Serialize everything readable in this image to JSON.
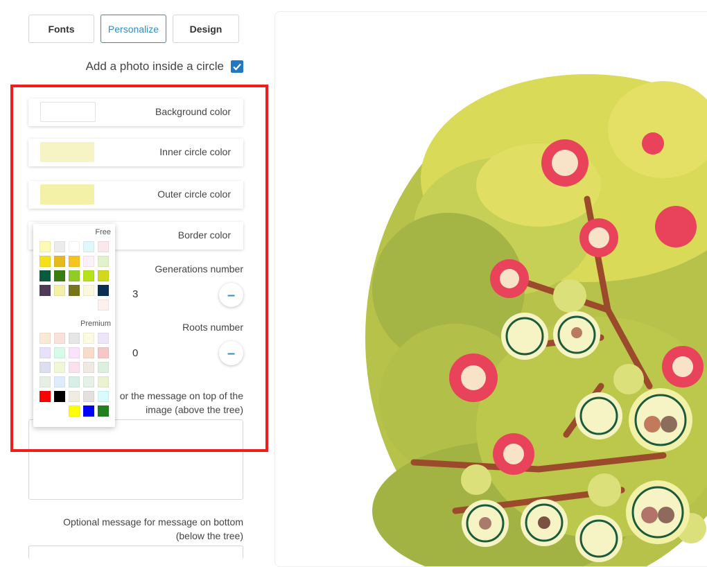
{
  "tabs": [
    {
      "label": "Fonts"
    },
    {
      "label": "Personalize"
    },
    {
      "label": "Design"
    }
  ],
  "photo_option": {
    "label": "Add a photo inside a circle",
    "checked": true
  },
  "colors": {
    "background": {
      "label": "Background color",
      "value": "#ffffff"
    },
    "inner": {
      "label": "Inner circle color",
      "value": "#f6f4c4"
    },
    "outer": {
      "label": "Outer circle color",
      "value": "#f3f0a8"
    },
    "border": {
      "label": "Border color"
    }
  },
  "generations": {
    "label": "Generations number",
    "value": "3"
  },
  "roots": {
    "label": "Roots number",
    "value": "0"
  },
  "top_message": {
    "label": "or the message on top of the image (above the tree)",
    "line1": "or the message on top of the",
    "line2": "image (above the tree)"
  },
  "bottom_message": {
    "line1": "Optional message for message on bottom",
    "line2": "(below the tree)"
  },
  "picker": {
    "free_label": "Free",
    "premium_label": "Premium",
    "free_colors": [
      "#fbfbb4",
      "#ececec",
      "#ffffff",
      "#e1f8fb",
      "#fbe7ec",
      "#f4e11c",
      "#e6b91f",
      "#f7c31e",
      "#fcf1fb",
      "#e2f2ca",
      "#0a5b3b",
      "#3a7d12",
      "#8fcc26",
      "#b6e21c",
      "#d2d81c",
      "#4e3a56",
      "#f5f0a8",
      "#77751c",
      "#faf7dc",
      "#092f52",
      "#ffffff",
      "#ffffff",
      "#ffffff",
      "#ffffff",
      "#fdf1ee"
    ],
    "premium_colors": [
      "#fbe9d6",
      "#fbe1dc",
      "#e6e6e6",
      "#fbfbe2",
      "#ede6fb",
      "#e6e2fb",
      "#d6fbe6",
      "#fbe2fb",
      "#f8dccc",
      "#f7c7c7",
      "#dcdff0",
      "#eff7d6",
      "#fbe1ed",
      "#f0e8e1",
      "#ddf0de",
      "#e6eee6",
      "#dfecfb",
      "#d8eee6",
      "#e6f0e6",
      "#eaf2d2",
      "#ff0000",
      "#000000",
      "#f0ece1",
      "#e4e0e0",
      "#d8fbfb",
      "#ffffff",
      "#ffffff",
      "#ffff00",
      "#0000ff",
      "#238020"
    ]
  },
  "accent_color": "#2d8fc4",
  "highlight_color": "#f11d1d"
}
